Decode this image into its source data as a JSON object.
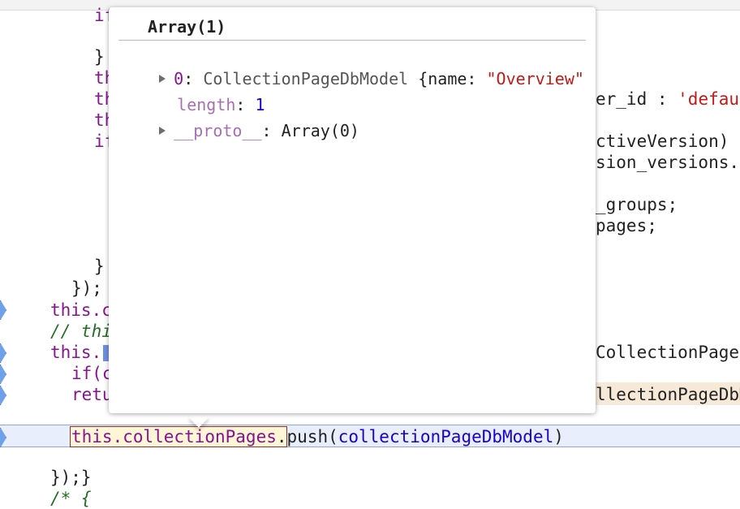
{
  "code_lines": [
    {
      "id": "l1",
      "text": "if"
    },
    {
      "id": "l2",
      "text": "}"
    },
    {
      "id": "l3",
      "text": "th"
    },
    {
      "id": "l4",
      "text": "th"
    },
    {
      "id": "l5",
      "text": "th"
    },
    {
      "id": "l6",
      "text": "if"
    },
    {
      "id": "l7",
      "text": "}"
    },
    {
      "id": "l8",
      "text": "});"
    },
    {
      "id": "l9",
      "text": "this.c"
    },
    {
      "id": "l10",
      "text": "// thi"
    },
    {
      "id": "l11",
      "text": "this."
    },
    {
      "id": "l12",
      "text": "if(c"
    },
    {
      "id": "l13",
      "text": "retu"
    },
    {
      "id": "l15",
      "text": "});}"
    },
    {
      "id": "l16",
      "text": "/* {"
    }
  ],
  "right_fragments": [
    {
      "id": "r1",
      "text": "er_id : ",
      "str": "'defaul"
    },
    {
      "id": "r2",
      "text": "ctiveVersion) -"
    },
    {
      "id": "r3",
      "text": "sion_versions.f"
    },
    {
      "id": "r4",
      "text": "_groups;"
    },
    {
      "id": "r5",
      "text": "pages;"
    },
    {
      "id": "r6",
      "text": "CollectionPage"
    },
    {
      "id": "r7",
      "text": "llectionPageDbM"
    }
  ],
  "exec_line": {
    "target": "this.collectionPages",
    "method": ".push(",
    "arg": "collectionPageDbModel",
    "close": ")"
  },
  "popover": {
    "title": "Array(1)",
    "rows": [
      {
        "key": "0",
        "sep": ": ",
        "type": "CollectionPageDbModel",
        "brace": " {name: ",
        "value": "\"Overview\""
      },
      {
        "key": "length",
        "sep": ": ",
        "value": "1"
      },
      {
        "key": "__proto__",
        "sep": ": ",
        "value": "Array(0)"
      }
    ]
  },
  "colors": {
    "keyword": "#881391",
    "string": "#c41a16",
    "comment": "#236e25",
    "number": "#1c00cf",
    "exec_highlight": "#e8eefc"
  },
  "icons": {
    "gutter": "breakpoint-marker-icon",
    "expand": "expand-triangle-icon"
  }
}
